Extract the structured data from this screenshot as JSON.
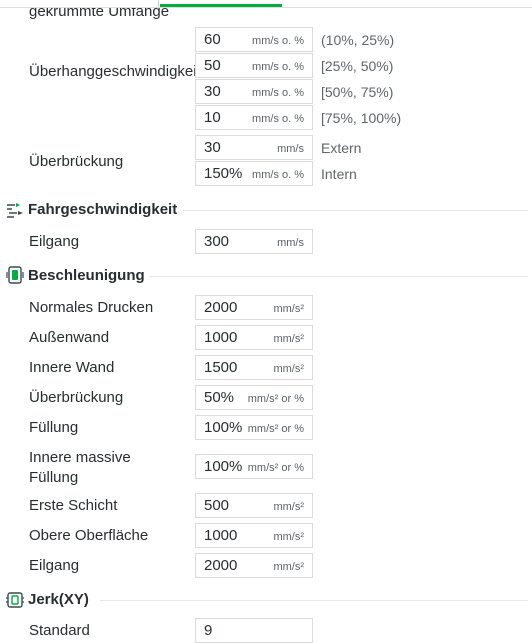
{
  "cut_label": "gekrümmte Umfänge",
  "overhang": {
    "label": "Überhanggeschwindigkeit",
    "rows": [
      {
        "value": "60",
        "unit": "mm/s o. %",
        "range": "(10%, 25%)"
      },
      {
        "value": "50",
        "unit": "mm/s o. %",
        "range": "[25%, 50%)"
      },
      {
        "value": "30",
        "unit": "mm/s o. %",
        "range": "[50%, 75%)"
      },
      {
        "value": "10",
        "unit": "mm/s o. %",
        "range": "[75%, 100%)"
      }
    ]
  },
  "bridge": {
    "label": "Überbrückung",
    "rows": [
      {
        "value": "30",
        "unit": "mm/s",
        "side": "Extern"
      },
      {
        "value": "150%",
        "unit": "mm/s o. %",
        "side": "Intern"
      }
    ]
  },
  "travel_section": {
    "title": "Fahrgeschwindigkeit",
    "icon": "travel-speed-icon",
    "rows": [
      {
        "label": "Eilgang",
        "value": "300",
        "unit": "mm/s"
      }
    ]
  },
  "accel_section": {
    "title": "Beschleunigung",
    "icon": "acceleration-icon",
    "rows": [
      {
        "label": "Normales Drucken",
        "value": "2000",
        "unit": "mm/s²"
      },
      {
        "label": "Außenwand",
        "value": "1000",
        "unit": "mm/s²"
      },
      {
        "label": "Innere Wand",
        "value": "1500",
        "unit": "mm/s²"
      },
      {
        "label": "Überbrückung",
        "value": "50%",
        "unit": "mm/s² or %"
      },
      {
        "label": "Füllung",
        "value": "100%",
        "unit": "mm/s² or %"
      },
      {
        "label": "Innere massive Füllung",
        "value": "100%",
        "unit": "mm/s² or %"
      },
      {
        "label": "Erste Schicht",
        "value": "500",
        "unit": "mm/s²"
      },
      {
        "label": "Obere Oberfläche",
        "value": "1000",
        "unit": "mm/s²"
      },
      {
        "label": "Eilgang",
        "value": "2000",
        "unit": "mm/s²"
      }
    ]
  },
  "jerk_section": {
    "title": "Jerk(XY)",
    "icon": "jerk-icon",
    "rows": [
      {
        "label": "Standard",
        "value": "9"
      }
    ]
  },
  "colors": {
    "accent": "#00ae42",
    "border": "#dbdbdb",
    "text": "#262e30",
    "muted": "#5f666a"
  }
}
